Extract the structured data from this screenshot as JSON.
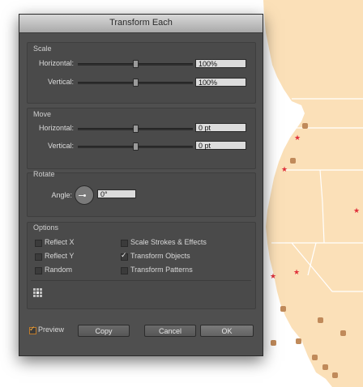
{
  "dialog": {
    "title": "Transform Each",
    "scale": {
      "legend": "Scale",
      "horizontal_label": "Horizontal:",
      "horizontal_value": "100%",
      "vertical_label": "Vertical:",
      "vertical_value": "100%"
    },
    "move": {
      "legend": "Move",
      "horizontal_label": "Horizontal:",
      "horizontal_value": "0 pt",
      "vertical_label": "Vertical:",
      "vertical_value": "0 pt"
    },
    "rotate": {
      "legend": "Rotate",
      "angle_label": "Angle:",
      "angle_value": "0°"
    },
    "options": {
      "legend": "Options",
      "reflect_x": {
        "label": "Reflect X",
        "checked": false
      },
      "reflect_y": {
        "label": "Reflect Y",
        "checked": false
      },
      "random": {
        "label": "Random",
        "checked": false
      },
      "scale_strokes": {
        "label": "Scale Strokes & Effects",
        "checked": false
      },
      "transform_objects": {
        "label": "Transform Objects",
        "checked": true
      },
      "transform_patterns": {
        "label": "Transform Patterns",
        "checked": false
      }
    },
    "preview": {
      "label": "Preview",
      "checked": true
    },
    "buttons": {
      "copy": "Copy",
      "cancel": "Cancel",
      "ok": "OK"
    }
  },
  "colors": {
    "map_land": "#fbe0b8",
    "map_border": "#ffffff",
    "star": "#e0303a",
    "dot": "#c08a5a",
    "ocean": "#ffffff"
  },
  "glyphs": {
    "checkmark": "✓",
    "star": "★"
  }
}
